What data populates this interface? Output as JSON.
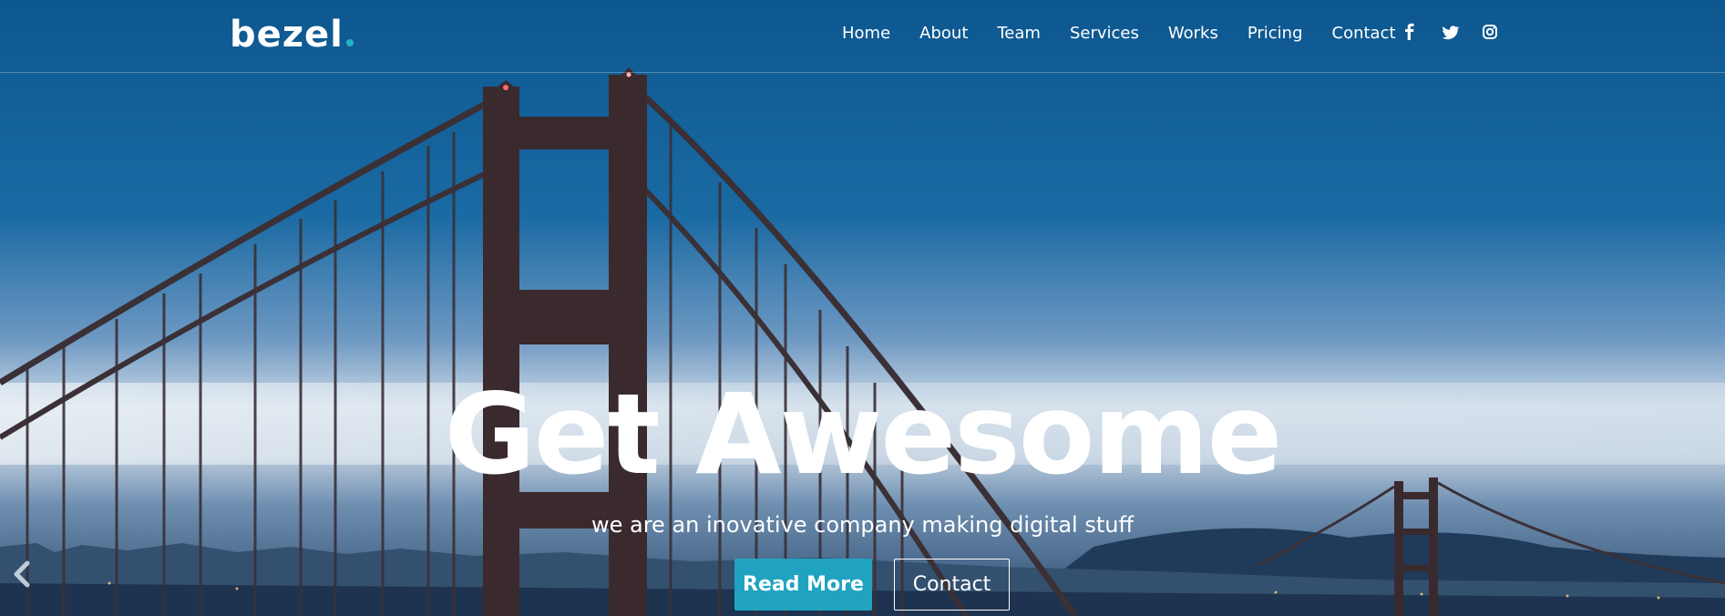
{
  "navbar": {
    "brand": "bezel",
    "links": [
      {
        "label": "Home"
      },
      {
        "label": "About"
      },
      {
        "label": "Team"
      },
      {
        "label": "Services"
      },
      {
        "label": "Works"
      },
      {
        "label": "Pricing"
      },
      {
        "label": "Contact"
      }
    ],
    "social_icons": [
      "facebook-icon",
      "twitter-icon",
      "instagram-icon"
    ]
  },
  "hero": {
    "headline": "Get Awesome",
    "tagline": "we are an inovative company making digital stuff",
    "primary_button": "Read More",
    "secondary_button": "Contact",
    "prev_control_icon": "chevron-left-icon"
  },
  "colors": {
    "accent": "#1fa3c1",
    "brand_dot": "#1fb6c9",
    "sky_top": "#0e5a93",
    "text": "#ffffff"
  }
}
